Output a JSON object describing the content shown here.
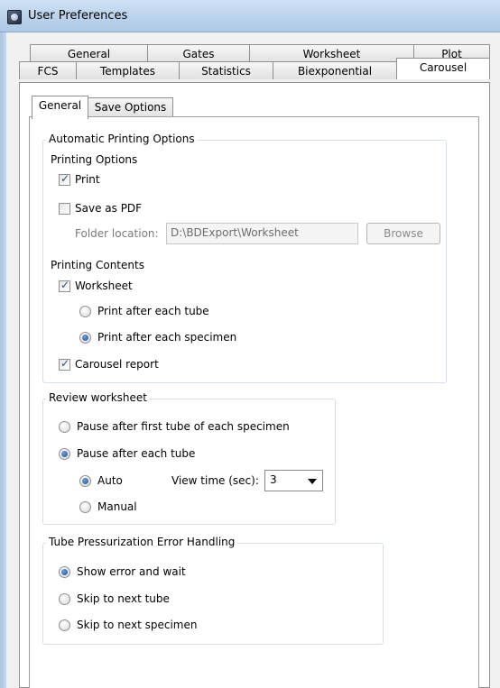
{
  "window": {
    "title": "User Preferences"
  },
  "tabs": {
    "row1": [
      {
        "label": "General"
      },
      {
        "label": "Gates"
      },
      {
        "label": "Worksheet"
      },
      {
        "label": "Plot"
      }
    ],
    "row2": [
      {
        "label": "FCS"
      },
      {
        "label": "Templates"
      },
      {
        "label": "Statistics"
      },
      {
        "label": "Biexponential"
      },
      {
        "label": "Carousel",
        "active": true
      }
    ]
  },
  "subtabs": [
    {
      "label": "General",
      "active": true
    },
    {
      "label": "Save Options"
    }
  ],
  "printing": {
    "group_title": "Automatic Printing Options",
    "options_heading": "Printing Options",
    "print_label": "Print",
    "print_checked": true,
    "save_pdf_label": "Save as PDF",
    "save_pdf_checked": false,
    "folder_label": "Folder location:",
    "folder_value": "D:\\BDExport\\Worksheet",
    "browse_label": "Browse",
    "contents_heading": "Printing Contents",
    "worksheet_label": "Worksheet",
    "worksheet_checked": true,
    "after_tube_label": "Print after each tube",
    "after_specimen_label": "Print after each specimen",
    "after_specimen_selected": true,
    "carousel_report_label": "Carousel report",
    "carousel_report_checked": true
  },
  "review": {
    "group_title": "Review worksheet",
    "pause_first_label": "Pause after first tube of each specimen",
    "pause_each_label": "Pause after each tube",
    "pause_each_selected": true,
    "auto_label": "Auto",
    "auto_selected": true,
    "view_time_label": "View time (sec):",
    "view_time_value": "3",
    "manual_label": "Manual"
  },
  "pressure": {
    "group_title": "Tube Pressurization Error Handling",
    "show_error_label": "Show error and wait",
    "show_error_selected": true,
    "skip_tube_label": "Skip to next tube",
    "skip_specimen_label": "Skip to next specimen"
  }
}
